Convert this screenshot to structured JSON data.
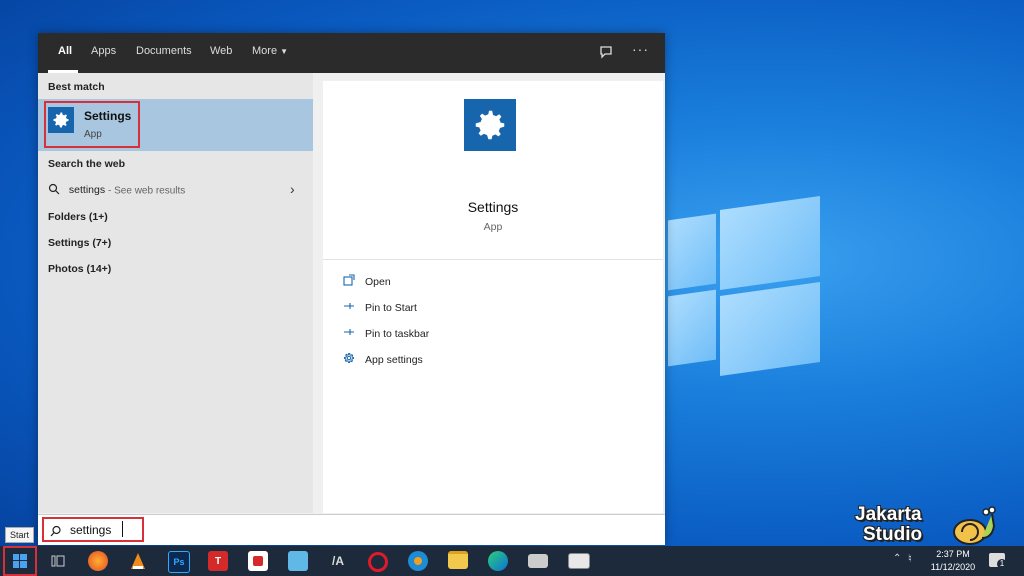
{
  "tabs": [
    {
      "label": "All",
      "active": true
    },
    {
      "label": "Apps"
    },
    {
      "label": "Documents"
    },
    {
      "label": "Web"
    },
    {
      "label": "More"
    }
  ],
  "left": {
    "best_match_label": "Best match",
    "best_match": {
      "title": "Settings",
      "subtitle": "App"
    },
    "search_web_label": "Search the web",
    "web_result": {
      "query": "settings",
      "hint": "- See web results"
    },
    "folders": "Folders (1+)",
    "settings": "Settings (7+)",
    "photos": "Photos (14+)"
  },
  "preview": {
    "title": "Settings",
    "subtitle": "App",
    "actions": [
      {
        "label": "Open",
        "icon": "open-icon"
      },
      {
        "label": "Pin to Start",
        "icon": "pin-icon"
      },
      {
        "label": "Pin to taskbar",
        "icon": "pin-icon"
      },
      {
        "label": "App settings",
        "icon": "gear-icon"
      }
    ]
  },
  "search": {
    "value": "settings"
  },
  "taskbar": {
    "start_tooltip": "Start",
    "time": "2:37 PM",
    "date": "11/12/2020",
    "notification_count": "1",
    "apps": [
      "Task View",
      "Firefox",
      "VLC",
      "Photoshop",
      "T",
      "Shot",
      "Notes",
      "Affinity",
      "Opera",
      "Network",
      "File Explorer",
      "Edge",
      "Printer",
      "Terminal"
    ]
  },
  "watermark": {
    "line1": "Jakarta",
    "line2": "Studio"
  },
  "colors": {
    "accent": "#1766ad",
    "highlight": "#d6303a",
    "taskbar": "#1d2a3b"
  }
}
